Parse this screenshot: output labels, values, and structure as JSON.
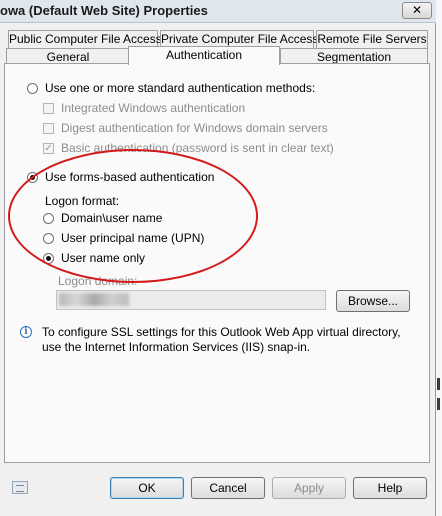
{
  "window": {
    "title": "owa (Default Web Site) Properties",
    "close_label": "✕"
  },
  "tabs_row1": [
    {
      "label": "Public Computer File Access"
    },
    {
      "label": "Private Computer File Access"
    },
    {
      "label": "Remote File Servers"
    }
  ],
  "tabs_row2": [
    {
      "label": "General"
    },
    {
      "label": "Authentication"
    },
    {
      "label": "Segmentation"
    }
  ],
  "auth": {
    "standard_label": "Use one or more standard authentication methods:",
    "standard_selected": false,
    "methods": [
      {
        "label": "Integrated Windows authentication",
        "checked": false
      },
      {
        "label": "Digest authentication for Windows domain servers",
        "checked": false
      },
      {
        "label": "Basic authentication (password is sent in clear text)",
        "checked": true
      }
    ],
    "forms_label": "Use forms-based authentication",
    "forms_selected": true,
    "logon_format_label": "Logon format:",
    "formats": [
      {
        "label": "Domain\\user name",
        "selected": false
      },
      {
        "label": "User principal name (UPN)",
        "selected": false
      },
      {
        "label": "User name only",
        "selected": true
      }
    ],
    "logon_domain_label": "Logon domain:",
    "browse_label": "Browse..."
  },
  "info": {
    "text": "To configure SSL settings for this Outlook Web App virtual directory, use the Internet Information Services (IIS) snap-in."
  },
  "buttons": {
    "ok": "OK",
    "cancel": "Cancel",
    "apply": "Apply",
    "help": "Help"
  },
  "colors": {
    "annotation": "#d41a1a",
    "info_icon": "#2c6fb7"
  }
}
